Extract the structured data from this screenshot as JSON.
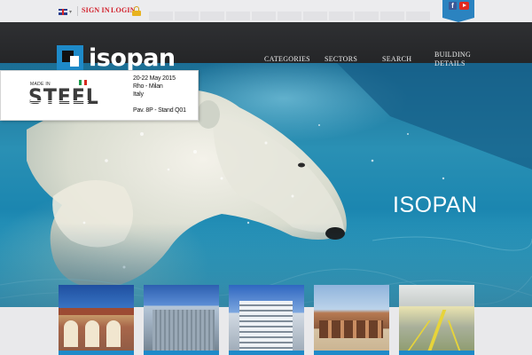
{
  "topbar": {
    "language_icon": "uk-flag-icon",
    "signin_label": "SIGN IN",
    "login_label": "LOGIN",
    "login_icon": "lock-icon"
  },
  "social": {
    "facebook_label": "f",
    "icons": [
      "facebook-icon",
      "youtube-icon"
    ]
  },
  "brand": {
    "name": "isopan"
  },
  "nav": {
    "items": [
      {
        "label": "CATEGORIES"
      },
      {
        "label": "SECTORS"
      },
      {
        "label": "SEARCH"
      },
      {
        "label": "BUILDING",
        "label2": "DETAILS"
      }
    ]
  },
  "event": {
    "logo_top": "MADE IN",
    "logo_word": "STEEL",
    "dates": "20-22 May 2015",
    "city": "Rho - Milan",
    "country": "Italy",
    "booth": "Pav. 8P - Stand Q01"
  },
  "hero": {
    "title": "ISOPAN"
  },
  "thumbnails": [
    {
      "name": "arched-building"
    },
    {
      "name": "grey-warehouse"
    },
    {
      "name": "striped-office"
    },
    {
      "name": "brick-barn"
    },
    {
      "name": "industrial-hall"
    }
  ],
  "colors": {
    "brand_blue": "#1e8ac9",
    "link_red": "#d21f2a",
    "nav_dark": "#2a2b2e"
  }
}
